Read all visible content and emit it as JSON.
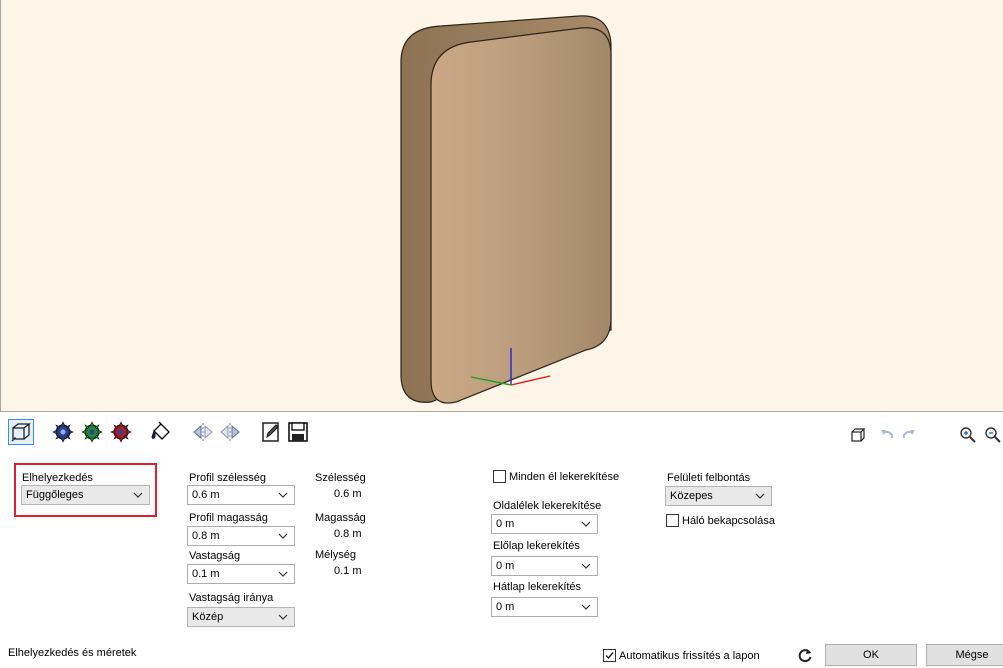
{
  "toolbar": {
    "icons": [
      "frame-select-icon",
      "blue-gear-icon",
      "green-gear-icon",
      "red-gear-icon",
      "paint-bucket-icon",
      "mirror-left-icon",
      "mirror-right-icon",
      "edit-document-icon",
      "save-icon",
      "cube-view-icon",
      "undo-icon",
      "redo-icon",
      "zoom-in-icon",
      "zoom-out-icon"
    ]
  },
  "placement": {
    "label": "Elhelyezkedés",
    "value": "Függőleges"
  },
  "profile": {
    "width_label": "Profil szélesség",
    "width_value": "0.6 m",
    "height_label": "Profil magasság",
    "height_value": "0.8 m",
    "thickness_label": "Vastagság",
    "thickness_value": "0.1 m",
    "thickness_dir_label": "Vastagság iránya",
    "thickness_dir_value": "Közép"
  },
  "dimensions": {
    "width_label": "Szélesség",
    "width_value": "0.6 m",
    "height_label": "Magasság",
    "height_value": "0.8 m",
    "depth_label": "Mélység",
    "depth_value": "0.1 m"
  },
  "rounding": {
    "all_edges_label": "Minden él lekerekítése",
    "all_edges_checked": false,
    "side_label": "Oldalélek lekerekítése",
    "side_value": "0 m",
    "front_label": "Előlap lekerekítés",
    "front_value": "0 m",
    "back_label": "Hátlap lekerekítés",
    "back_value": "0 m"
  },
  "surface": {
    "resolution_label": "Felületi felbontás",
    "resolution_value": "Közepes",
    "mesh_label": "Háló bekapcsolása",
    "mesh_checked": false
  },
  "footer": {
    "section_title": "Elhelyezkedés és méretek",
    "auto_refresh_label": "Automatikus frissítés a lapon",
    "auto_refresh_checked": true,
    "ok_label": "OK",
    "cancel_label": "Mégse"
  },
  "colors": {
    "viewport_bg": "#fdf5e8",
    "panel_front": "#c9a888",
    "panel_side": "#9c7e5f",
    "highlight": "#e0202f"
  }
}
